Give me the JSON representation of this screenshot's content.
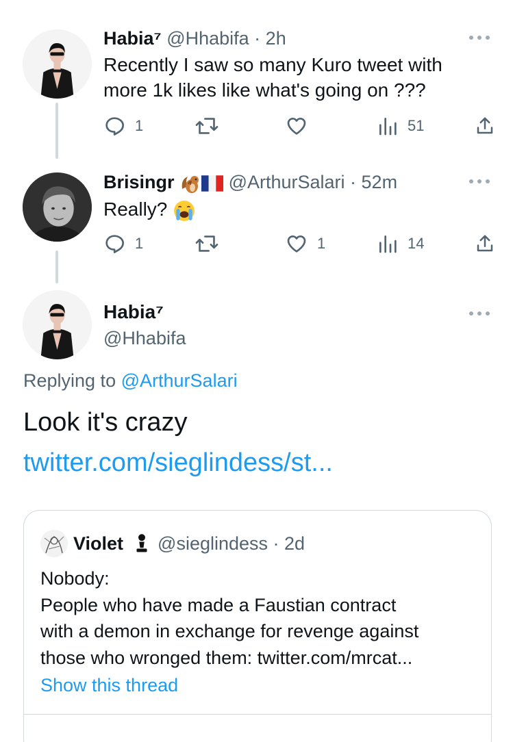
{
  "tweets": [
    {
      "display_name": "Habia⁷",
      "handle": "@Hhabifa",
      "time": "2h",
      "text_line1": "Recently I saw so many Kuro tweet with",
      "text_line2": "more 1k likes like what's going on ???",
      "replies": "1",
      "retweets": "",
      "likes": "",
      "views": "51",
      "avatar_icon": "person-in-sunglasses-avatar"
    },
    {
      "display_name": "Brisingr",
      "name_emojis": [
        "chipmunk-emoji",
        "france-flag-emoji"
      ],
      "handle": "@ArthurSalari",
      "time": "52m",
      "text": "Really?",
      "text_emoji": "loudly-crying-face-emoji",
      "replies": "1",
      "retweets": "",
      "likes": "1",
      "views": "14",
      "avatar_icon": "grayscale-person-avatar"
    }
  ],
  "focus_tweet": {
    "display_name": "Habia⁷",
    "handle": "@Hhabifa",
    "replying_prefix": "Replying to",
    "replying_to": "@ArthurSalari",
    "text": "Look it's crazy",
    "link": "twitter.com/sieglindess/st..."
  },
  "quoted_tweet": {
    "display_name": "Violet",
    "name_emoji": "chess-pawn-icon",
    "handle": "@sieglindess",
    "time": "2d",
    "lines": [
      "Nobody:",
      "People who have made a Faustian contract",
      "with a demon in exchange for revenge against",
      "those who wronged them: twitter.com/mrcat..."
    ],
    "show_thread": "Show this thread"
  },
  "colors": {
    "accent": "#1d9bf0",
    "muted": "#536471",
    "border": "#cfd9de",
    "text": "#0f1419"
  }
}
